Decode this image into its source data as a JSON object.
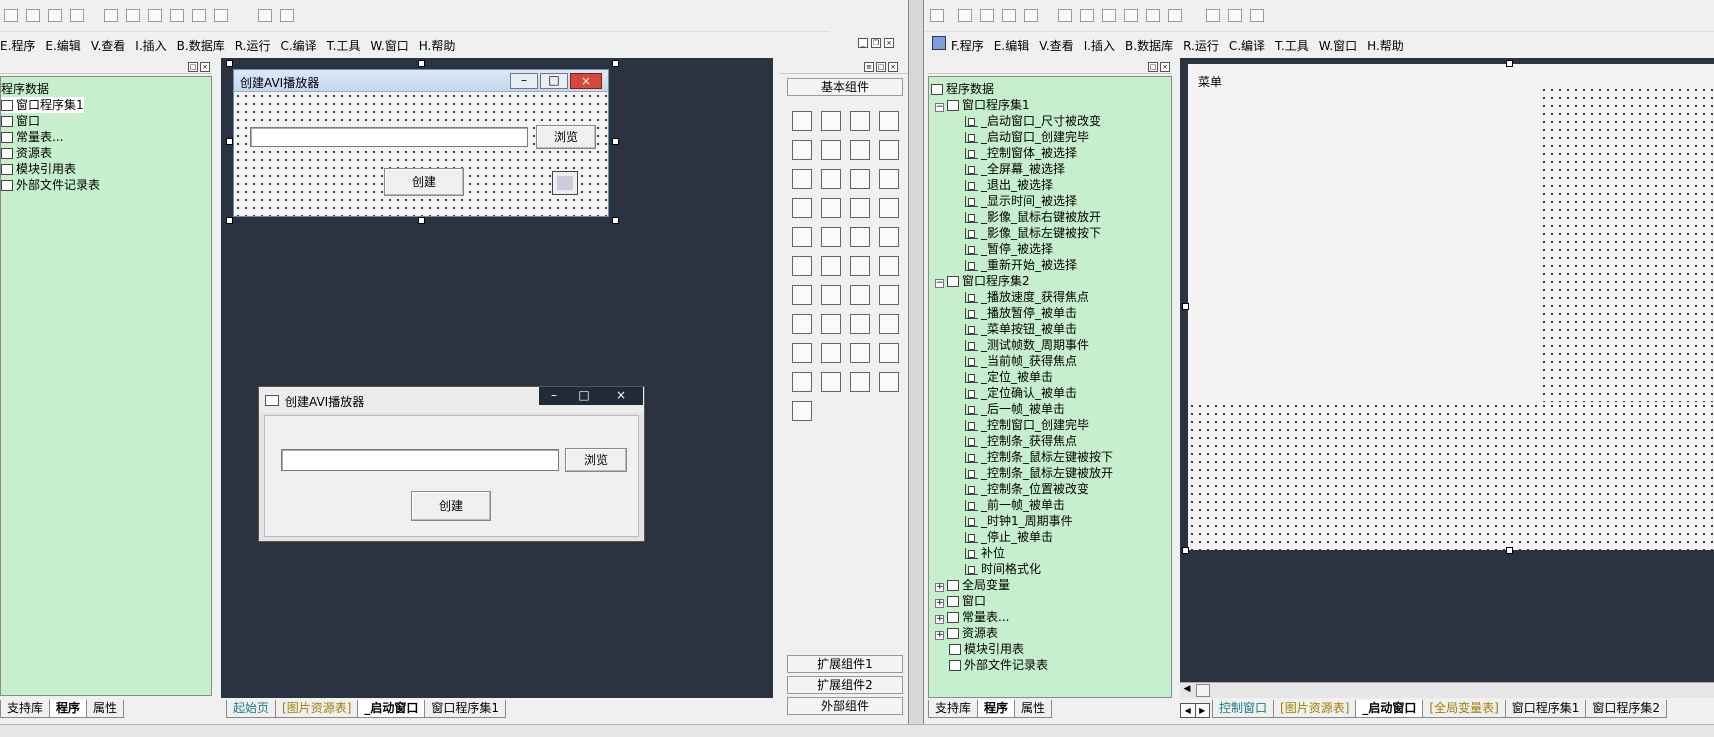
{
  "left_menu": [
    "E.程序",
    "E.编辑",
    "V.查看",
    "I.插入",
    "B.数据库",
    "R.运行",
    "C.编译",
    "T.工具",
    "W.窗口",
    "H.帮助"
  ],
  "right_menu": [
    "F.程序",
    "E.编辑",
    "V.查看",
    "I.插入",
    "B.数据库",
    "R.运行",
    "C.编译",
    "T.工具",
    "W.窗口",
    "H.帮助"
  ],
  "left_tree": {
    "items": [
      "程序数据",
      "窗口程序集1",
      "窗口",
      "常量表...",
      "资源表",
      "模块引用表",
      "外部文件记录表"
    ]
  },
  "designer_form": {
    "title": "创建AVI播放器",
    "browse_label": "浏览",
    "create_label": "创建",
    "input_value": ""
  },
  "preview_form": {
    "title": "创建AVI播放器",
    "browse_label": "浏览",
    "create_label": "创建",
    "input_value": ""
  },
  "palette": {
    "header": "基本组件",
    "groups": [
      "扩展组件1",
      "扩展组件2",
      "外部组件"
    ]
  },
  "left_bottom_tabs": [
    "支持库",
    "程序",
    "属性"
  ],
  "left_editor_tabs": [
    "起始页",
    "[图片资源表]",
    "_启动窗口",
    "窗口程序集1"
  ],
  "right_tree": {
    "root": "程序数据",
    "set1": "窗口程序集1",
    "set1_items": [
      "_启动窗口_尺寸被改变",
      "_启动窗口_创建完毕",
      "_控制窗体_被选择",
      "_全屏幕_被选择",
      "_退出_被选择",
      "_显示时间_被选择",
      "_影像_鼠标右键被放开",
      "_影像_鼠标左键被按下",
      "_暂停_被选择",
      "_重新开始_被选择"
    ],
    "set2": "窗口程序集2",
    "set2_items": [
      "_播放速度_获得焦点",
      "_播放暂停_被单击",
      "_菜单按钮_被单击",
      "_测试帧数_周期事件",
      "_当前帧_获得焦点",
      "_定位_被单击",
      "_定位确认_被单击",
      "_后一帧_被单击",
      "_控制窗口_创建完毕",
      "_控制条_获得焦点",
      "_控制条_鼠标左键被按下",
      "_控制条_鼠标左键被放开",
      "_控制条_位置被改变",
      "_前一帧_被单击",
      "_时钟1_周期事件",
      "_停止_被单击",
      "补位",
      "时间格式化"
    ],
    "tail": [
      "全局变量",
      "窗口",
      "常量表...",
      "资源表",
      "模块引用表",
      "外部文件记录表"
    ]
  },
  "right_form": {
    "menu_label": "菜单"
  },
  "right_bottom_tabs": [
    "支持库",
    "程序",
    "属性"
  ],
  "right_editor_tabs": [
    "控制窗口",
    "[图片资源表]",
    "_启动窗口",
    "[全局变量表]",
    "窗口程序集1",
    "窗口程序集2"
  ]
}
